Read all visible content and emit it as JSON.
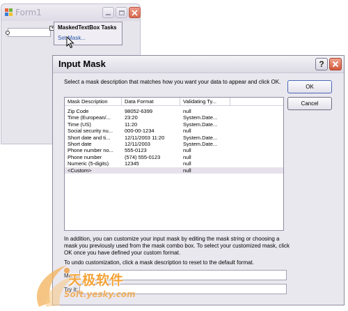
{
  "form1": {
    "title": "Form1"
  },
  "smart_tag": {
    "title": "MaskedTextBox Tasks",
    "link": "Set Mask..."
  },
  "dialog": {
    "title": "Input Mask",
    "help_label": "?",
    "instructions": "Select a mask description that matches how you want your data to appear and click OK.",
    "ok_label": "OK",
    "cancel_label": "Cancel",
    "columns": [
      "Mask Description",
      "Data Format",
      "Validating Ty..."
    ],
    "rows": [
      [
        "Zip Code",
        "98052-6399",
        "null"
      ],
      [
        "Time (European/...",
        "23:20",
        "System.Date..."
      ],
      [
        "Time (US)",
        "11:20",
        "System.Date..."
      ],
      [
        "Social security nu...",
        "000-00-1234",
        "null"
      ],
      [
        "Short date and ti...",
        "12/11/2003 11:20",
        "System.Date..."
      ],
      [
        "Short date",
        "12/11/2003",
        "System.Date..."
      ],
      [
        "Phone number no...",
        "555-0123",
        "null"
      ],
      [
        "Phone number",
        "(574) 555-0123",
        "null"
      ],
      [
        "Numeric (5-digits)",
        "12345",
        "null"
      ],
      [
        "<Custom>",
        "",
        "null"
      ]
    ],
    "selected_row": 9,
    "customize_text": "In addition, you can customize your input mask by editing the mask string or choosing a mask you previously used from the mask combo box.  To select your customized mask, click OK once you have defined your custom format.",
    "undo_text": "To undo customization, click a mask description to reset to the default format.",
    "mask_label": "Mask:",
    "mask_value": "",
    "try_label": "Try it:",
    "try_value": ""
  },
  "watermark": {
    "text": "天极软件",
    "url": "Soft.yesky.com"
  }
}
